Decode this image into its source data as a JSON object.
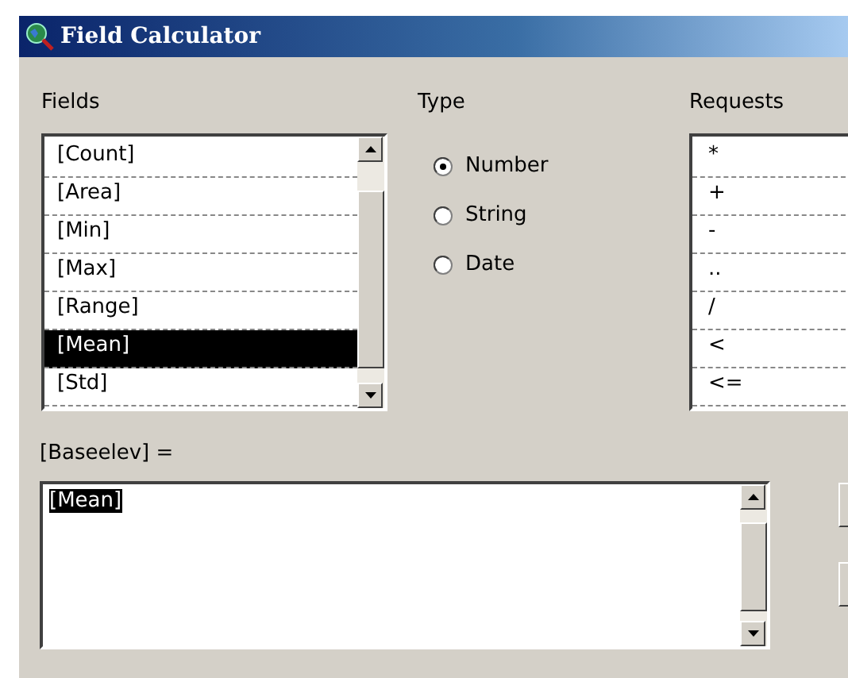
{
  "window": {
    "title": "Field Calculator"
  },
  "fields": {
    "label": "Fields",
    "items": [
      {
        "label": "[Count]",
        "selected": false
      },
      {
        "label": "[Area]",
        "selected": false
      },
      {
        "label": "[Min]",
        "selected": false
      },
      {
        "label": "[Max]",
        "selected": false
      },
      {
        "label": "[Range]",
        "selected": false
      },
      {
        "label": "[Mean]",
        "selected": true
      },
      {
        "label": "[Std]",
        "selected": false
      }
    ]
  },
  "type": {
    "label": "Type",
    "options": [
      {
        "label": "Number",
        "selected": true
      },
      {
        "label": "String",
        "selected": false
      },
      {
        "label": "Date",
        "selected": false
      }
    ]
  },
  "requests": {
    "label": "Requests",
    "items": [
      {
        "label": "*",
        "selected": false
      },
      {
        "label": "+",
        "selected": false
      },
      {
        "label": "-",
        "selected": false
      },
      {
        "label": "..",
        "selected": false
      },
      {
        "label": "/",
        "selected": false
      },
      {
        "label": "<",
        "selected": false
      },
      {
        "label": "<=",
        "selected": false
      }
    ]
  },
  "expression": {
    "label": "[Baseelev] =",
    "value": "[Mean]",
    "value_selected": true
  }
}
